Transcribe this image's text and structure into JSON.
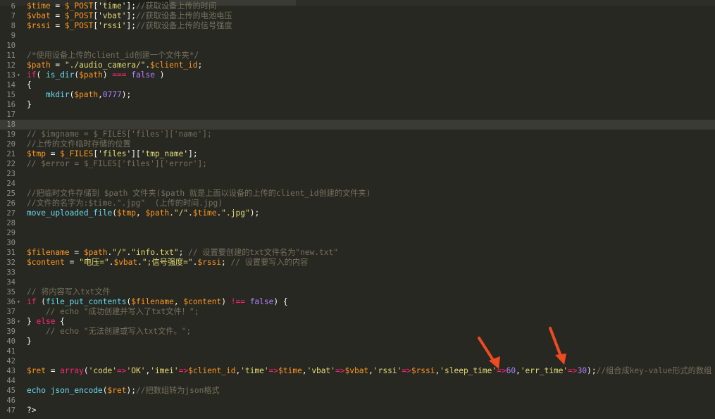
{
  "tabs": [
    "",
    "",
    "",
    ""
  ],
  "lines": [
    {
      "n": "6",
      "fold": false,
      "parts": [
        {
          "t": "$time",
          "c": "v"
        },
        {
          "t": " = "
        },
        {
          "t": "$_POST",
          "c": "v"
        },
        {
          "t": "['"
        },
        {
          "t": "time",
          "c": "s"
        },
        {
          "t": "'];"
        },
        {
          "t": "//获取设备上传的时间",
          "c": "c"
        }
      ]
    },
    {
      "n": "7",
      "fold": false,
      "parts": [
        {
          "t": "$vbat",
          "c": "v"
        },
        {
          "t": " = "
        },
        {
          "t": "$_POST",
          "c": "v"
        },
        {
          "t": "['"
        },
        {
          "t": "vbat",
          "c": "s"
        },
        {
          "t": "'];"
        },
        {
          "t": "//获取设备上传的电池电压",
          "c": "c"
        }
      ]
    },
    {
      "n": "8",
      "fold": false,
      "parts": [
        {
          "t": "$rssi",
          "c": "v"
        },
        {
          "t": " = "
        },
        {
          "t": "$_POST",
          "c": "v"
        },
        {
          "t": "['"
        },
        {
          "t": "rssi",
          "c": "s"
        },
        {
          "t": "'];"
        },
        {
          "t": "//获取设备上传的信号强度",
          "c": "c"
        }
      ]
    },
    {
      "n": "9",
      "fold": false,
      "parts": []
    },
    {
      "n": "10",
      "fold": false,
      "parts": []
    },
    {
      "n": "11",
      "fold": false,
      "parts": [
        {
          "t": "/*使用设备上传的client_id创建一个文件夹*/",
          "c": "c"
        }
      ]
    },
    {
      "n": "12",
      "fold": false,
      "parts": [
        {
          "t": "$path",
          "c": "v"
        },
        {
          "t": " = "
        },
        {
          "t": "\"./audio_camera/\"",
          "c": "s"
        },
        {
          "t": "."
        },
        {
          "t": "$client_id",
          "c": "v"
        },
        {
          "t": ";"
        }
      ]
    },
    {
      "n": "13",
      "fold": true,
      "parts": [
        {
          "t": "if",
          "c": "k"
        },
        {
          "t": "( "
        },
        {
          "t": "is_dir",
          "c": "f"
        },
        {
          "t": "("
        },
        {
          "t": "$path",
          "c": "v"
        },
        {
          "t": ") "
        },
        {
          "t": "===",
          "c": "k"
        },
        {
          "t": " "
        },
        {
          "t": "false",
          "c": "n"
        },
        {
          "t": " )"
        }
      ]
    },
    {
      "n": "14",
      "fold": false,
      "parts": [
        {
          "t": "{"
        }
      ]
    },
    {
      "n": "15",
      "fold": false,
      "parts": [
        {
          "t": "    "
        },
        {
          "t": "mkdir",
          "c": "f"
        },
        {
          "t": "("
        },
        {
          "t": "$path",
          "c": "v"
        },
        {
          "t": ","
        },
        {
          "t": "0777",
          "c": "n"
        },
        {
          "t": ");"
        }
      ]
    },
    {
      "n": "16",
      "fold": false,
      "parts": [
        {
          "t": "}"
        }
      ]
    },
    {
      "n": "17",
      "fold": false,
      "parts": []
    },
    {
      "n": "18",
      "fold": false,
      "current": true,
      "parts": []
    },
    {
      "n": "19",
      "fold": false,
      "parts": [
        {
          "t": "// $imgname = $_FILES['files']['name'];",
          "c": "c"
        }
      ]
    },
    {
      "n": "20",
      "fold": false,
      "parts": [
        {
          "t": "//上传的文件临时存储的位置",
          "c": "c"
        }
      ]
    },
    {
      "n": "21",
      "fold": false,
      "parts": [
        {
          "t": "$tmp",
          "c": "v"
        },
        {
          "t": " = "
        },
        {
          "t": "$_FILES",
          "c": "v"
        },
        {
          "t": "['"
        },
        {
          "t": "files",
          "c": "s"
        },
        {
          "t": "']['"
        },
        {
          "t": "tmp_name",
          "c": "s"
        },
        {
          "t": "'];"
        }
      ]
    },
    {
      "n": "22",
      "fold": false,
      "parts": [
        {
          "t": "// $error = $_FILES['files']['error'];",
          "c": "c"
        }
      ]
    },
    {
      "n": "23",
      "fold": false,
      "parts": []
    },
    {
      "n": "24",
      "fold": false,
      "parts": []
    },
    {
      "n": "25",
      "fold": false,
      "parts": [
        {
          "t": "//把临时文件存储到 $path 文件夹($path 就是上面以设备的上传的client_id创建的文件夹)",
          "c": "c"
        }
      ]
    },
    {
      "n": "26",
      "fold": false,
      "parts": [
        {
          "t": "//文件的名字为:$time.\".jpg\"  (上传的时间.jpg)",
          "c": "c"
        }
      ]
    },
    {
      "n": "27",
      "fold": false,
      "parts": [
        {
          "t": "move_uploaded_file",
          "c": "f"
        },
        {
          "t": "("
        },
        {
          "t": "$tmp",
          "c": "v"
        },
        {
          "t": ", "
        },
        {
          "t": "$path",
          "c": "v"
        },
        {
          "t": "."
        },
        {
          "t": "\"/\"",
          "c": "s"
        },
        {
          "t": "."
        },
        {
          "t": "$time",
          "c": "v"
        },
        {
          "t": "."
        },
        {
          "t": "\".jpg\"",
          "c": "s"
        },
        {
          "t": ");"
        }
      ]
    },
    {
      "n": "28",
      "fold": false,
      "parts": []
    },
    {
      "n": "29",
      "fold": false,
      "parts": []
    },
    {
      "n": "30",
      "fold": false,
      "parts": []
    },
    {
      "n": "31",
      "fold": false,
      "parts": [
        {
          "t": "$filename",
          "c": "v"
        },
        {
          "t": " = "
        },
        {
          "t": "$path",
          "c": "v"
        },
        {
          "t": "."
        },
        {
          "t": "\"/\"",
          "c": "s"
        },
        {
          "t": "."
        },
        {
          "t": "\"info.txt\"",
          "c": "s"
        },
        {
          "t": "; "
        },
        {
          "t": "// 设置要创建的txt文件名为\"new.txt\"",
          "c": "c"
        }
      ]
    },
    {
      "n": "32",
      "fold": false,
      "parts": [
        {
          "t": "$content",
          "c": "v"
        },
        {
          "t": " = "
        },
        {
          "t": "\"电压=\"",
          "c": "s"
        },
        {
          "t": "."
        },
        {
          "t": "$vbat",
          "c": "v"
        },
        {
          "t": "."
        },
        {
          "t": "\";信号强度=\"",
          "c": "s"
        },
        {
          "t": "."
        },
        {
          "t": "$rssi",
          "c": "v"
        },
        {
          "t": "; "
        },
        {
          "t": "// 设置要写入的内容",
          "c": "c"
        }
      ]
    },
    {
      "n": "33",
      "fold": false,
      "parts": []
    },
    {
      "n": "34",
      "fold": false,
      "parts": []
    },
    {
      "n": "35",
      "fold": false,
      "parts": [
        {
          "t": "// 将内容写入txt文件",
          "c": "c"
        }
      ]
    },
    {
      "n": "36",
      "fold": true,
      "parts": [
        {
          "t": "if",
          "c": "k"
        },
        {
          "t": " ("
        },
        {
          "t": "file_put_contents",
          "c": "f"
        },
        {
          "t": "("
        },
        {
          "t": "$filename",
          "c": "v"
        },
        {
          "t": ", "
        },
        {
          "t": "$content",
          "c": "v"
        },
        {
          "t": ") "
        },
        {
          "t": "!==",
          "c": "k"
        },
        {
          "t": " "
        },
        {
          "t": "false",
          "c": "n"
        },
        {
          "t": ") {"
        }
      ]
    },
    {
      "n": "37",
      "fold": false,
      "parts": [
        {
          "t": "    // echo \"成功创建并写入了txt文件！\";",
          "c": "c"
        }
      ]
    },
    {
      "n": "38",
      "fold": true,
      "parts": [
        {
          "t": "} "
        },
        {
          "t": "else",
          "c": "k"
        },
        {
          "t": " {"
        }
      ]
    },
    {
      "n": "39",
      "fold": false,
      "parts": [
        {
          "t": "    // echo \"无法创建或写入txt文件。\";",
          "c": "c"
        }
      ]
    },
    {
      "n": "40",
      "fold": false,
      "parts": [
        {
          "t": "}"
        }
      ]
    },
    {
      "n": "41",
      "fold": false,
      "parts": []
    },
    {
      "n": "42",
      "fold": false,
      "parts": []
    },
    {
      "n": "43",
      "fold": false,
      "parts": [
        {
          "t": "$ret",
          "c": "v"
        },
        {
          "t": " = "
        },
        {
          "t": "array",
          "c": "k"
        },
        {
          "t": "("
        },
        {
          "t": "'code'",
          "c": "s"
        },
        {
          "t": "=>",
          "c": "k"
        },
        {
          "t": "'OK'",
          "c": "s"
        },
        {
          "t": ","
        },
        {
          "t": "'imei'",
          "c": "s"
        },
        {
          "t": "=>",
          "c": "k"
        },
        {
          "t": "$client_id",
          "c": "v"
        },
        {
          "t": ","
        },
        {
          "t": "'time'",
          "c": "s"
        },
        {
          "t": "=>",
          "c": "k"
        },
        {
          "t": "$time",
          "c": "v"
        },
        {
          "t": ","
        },
        {
          "t": "'vbat'",
          "c": "s"
        },
        {
          "t": "=>",
          "c": "k"
        },
        {
          "t": "$vbat",
          "c": "v"
        },
        {
          "t": ","
        },
        {
          "t": "'rssi'",
          "c": "s"
        },
        {
          "t": "=>",
          "c": "k"
        },
        {
          "t": "$rssi",
          "c": "v"
        },
        {
          "t": ","
        },
        {
          "t": "'sleep_time'",
          "c": "s"
        },
        {
          "t": "=>",
          "c": "k"
        },
        {
          "t": "60",
          "c": "n"
        },
        {
          "t": ","
        },
        {
          "t": "'err_time'",
          "c": "s"
        },
        {
          "t": "=>",
          "c": "k"
        },
        {
          "t": "30",
          "c": "n"
        },
        {
          "t": ");"
        },
        {
          "t": "//组合成key-value形式的数组",
          "c": "c"
        }
      ]
    },
    {
      "n": "44",
      "fold": false,
      "parts": []
    },
    {
      "n": "45",
      "fold": false,
      "parts": [
        {
          "t": "echo",
          "c": "f"
        },
        {
          "t": " "
        },
        {
          "t": "json_encode",
          "c": "f"
        },
        {
          "t": "("
        },
        {
          "t": "$ret",
          "c": "v"
        },
        {
          "t": ");"
        },
        {
          "t": "//把数组转为json格式",
          "c": "c"
        }
      ]
    },
    {
      "n": "46",
      "fold": false,
      "parts": []
    },
    {
      "n": "47",
      "fold": false,
      "parts": [
        {
          "t": "?>"
        }
      ]
    }
  ],
  "colors": {
    "background": "#272822",
    "annotation_arrow": "#ef4a21"
  }
}
